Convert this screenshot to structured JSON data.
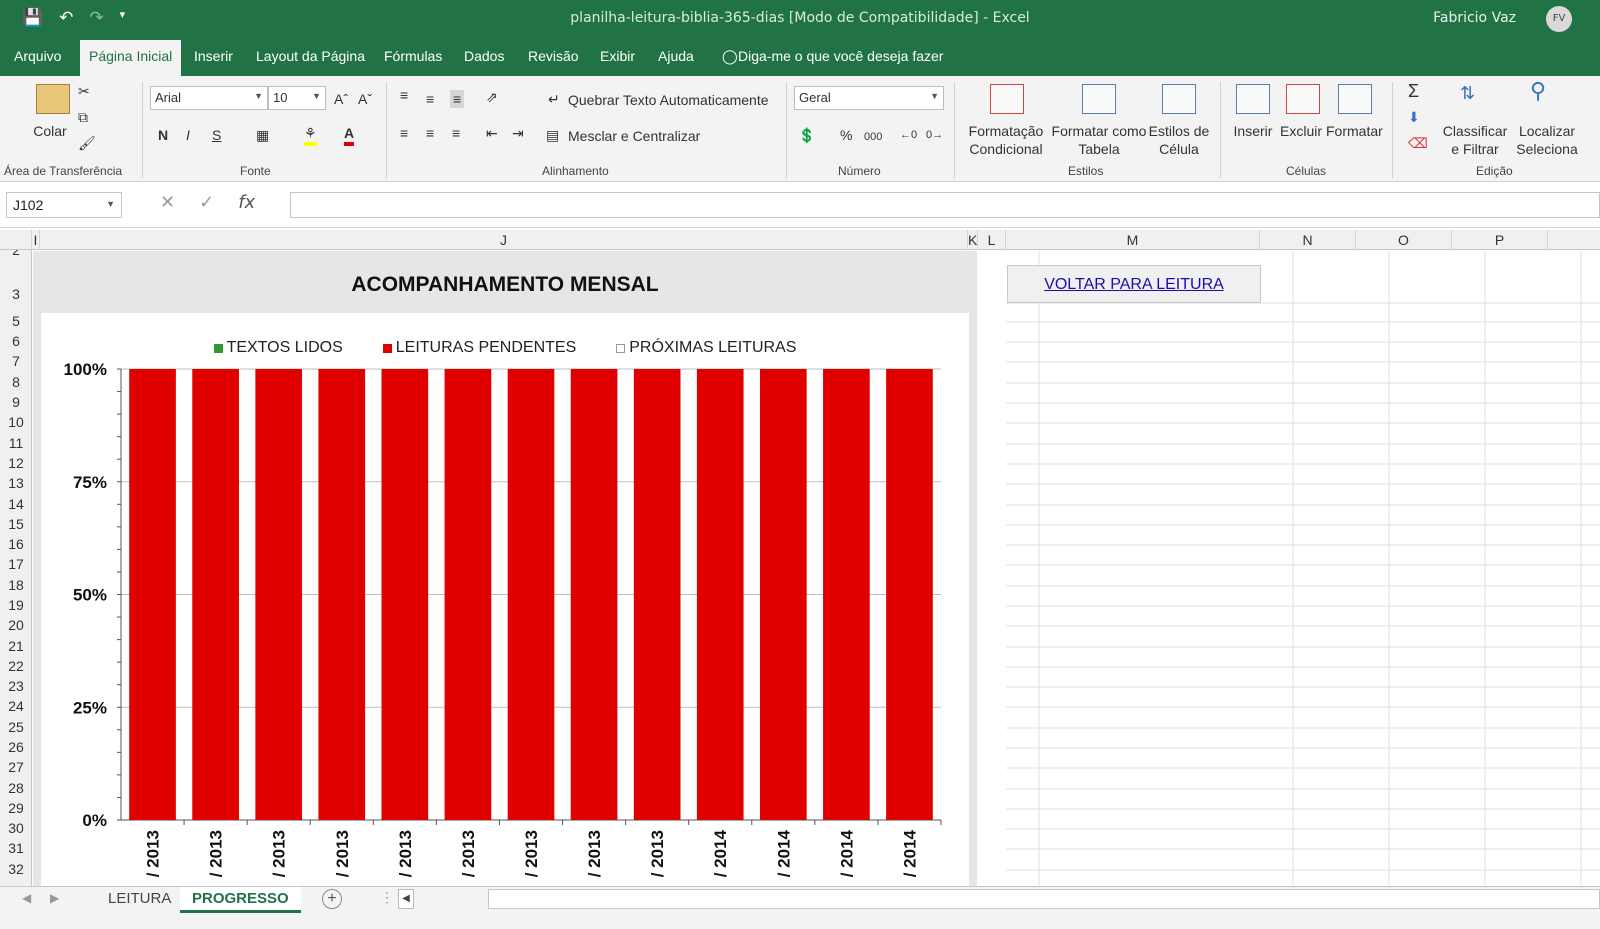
{
  "window": {
    "title": "planilha-leitura-biblia-365-dias  [Modo de Compatibilidade]  -  Excel",
    "user": "Fabricio Vaz",
    "avatar": "FV"
  },
  "ribbon_tabs": [
    "Arquivo",
    "Página Inicial",
    "Inserir",
    "Layout da Página",
    "Fórmulas",
    "Dados",
    "Revisão",
    "Exibir",
    "Ajuda"
  ],
  "tell_me": "Diga-me o que você deseja fazer",
  "ribbon": {
    "clipboard": {
      "paste": "Colar",
      "label": "Área de Transferência"
    },
    "font": {
      "name": "Arial",
      "size": "10",
      "bold": "N",
      "italic": "I",
      "underline": "S",
      "label": "Fonte"
    },
    "alignment": {
      "wrap": "Quebrar Texto Automaticamente",
      "merge": "Mesclar e Centralizar",
      "label": "Alinhamento"
    },
    "number": {
      "format": "Geral",
      "percent": "%",
      "thousands": "000",
      "label": "Número"
    },
    "styles": {
      "conditional_1": "Formatação",
      "conditional_2": "Condicional",
      "table_1": "Formatar como",
      "table_2": "Tabela",
      "cell_1": "Estilos de",
      "cell_2": "Célula",
      "label": "Estilos"
    },
    "cells": {
      "insert": "Inserir",
      "delete": "Excluir",
      "format": "Formatar",
      "label": "Células"
    },
    "editing": {
      "sort_1": "Classificar",
      "sort_2": "e Filtrar",
      "find_1": "Localizar",
      "find_2": "Seleciona",
      "label": "Edição"
    }
  },
  "formula_bar": {
    "name_box": "J102",
    "fx": "fx",
    "cancel": "✕",
    "enter": "✓",
    "formula": ""
  },
  "columns": [
    "I",
    "J",
    "K",
    "L",
    "M",
    "N",
    "O",
    "P"
  ],
  "rows": [
    "2",
    "3",
    "5",
    "6",
    "7",
    "8",
    "9",
    "10",
    "11",
    "12",
    "13",
    "14",
    "15",
    "16",
    "17",
    "18",
    "19",
    "20",
    "21",
    "22",
    "23",
    "24",
    "25",
    "26",
    "27",
    "28",
    "29",
    "30",
    "31",
    "32"
  ],
  "link_cell": "VOLTAR PARA LEITURA",
  "sheets": {
    "tabs": [
      "LEITURA",
      "PROGRESSO"
    ],
    "active": "PROGRESSO"
  },
  "chart_data": {
    "type": "bar",
    "title": "ACOMPANHAMENTO MENSAL",
    "stacked": "100%",
    "categories": [
      "/ 2013",
      "/ 2013",
      "/ 2013",
      "/ 2013",
      "/ 2013",
      "/ 2013",
      "/ 2013",
      "/ 2013",
      "/ 2013",
      "/ 2014",
      "/ 2014",
      "/ 2014",
      "/ 2014"
    ],
    "series": [
      {
        "name": "TEXTOS LIDOS",
        "color": "#339933",
        "values": [
          0,
          0,
          0,
          0,
          0,
          0,
          0,
          0,
          0,
          0,
          0,
          0,
          0
        ]
      },
      {
        "name": "LEITURAS PENDENTES",
        "color": "#e00000",
        "values": [
          1,
          1,
          1,
          1,
          1,
          1,
          1,
          1,
          1,
          1,
          1,
          1,
          1
        ]
      },
      {
        "name": "PRÓXIMAS LEITURAS",
        "color": "#ffffff",
        "values": [
          0,
          0,
          0,
          0,
          0,
          0,
          0,
          0,
          0,
          0,
          0,
          0,
          0
        ]
      }
    ],
    "yticks": [
      "0%",
      "25%",
      "50%",
      "75%",
      "100%"
    ],
    "ylim": [
      0,
      1
    ],
    "grid": true,
    "legend": "top"
  }
}
